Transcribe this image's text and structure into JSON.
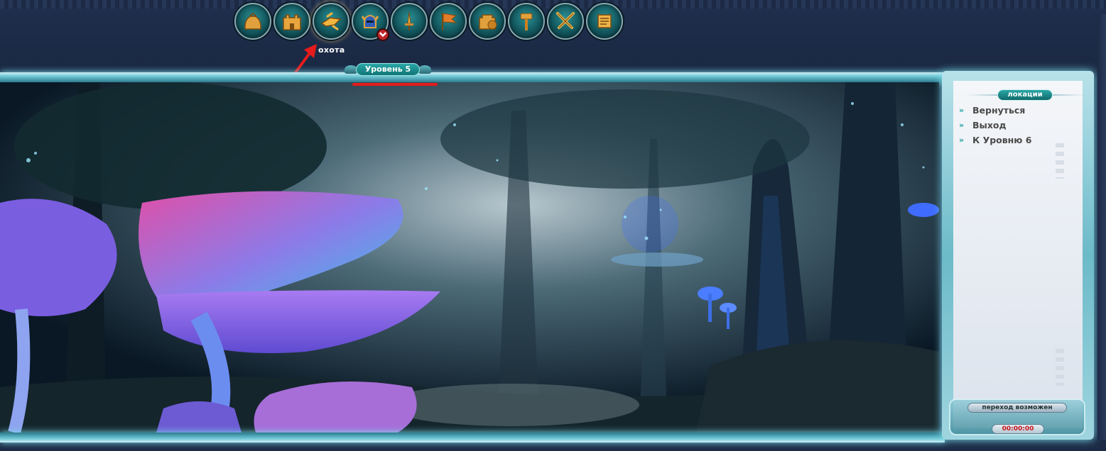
{
  "toolbar": {
    "buttons": [
      {
        "name": "bag",
        "label": ""
      },
      {
        "name": "castle",
        "label": ""
      },
      {
        "name": "hunt",
        "label": "охота"
      },
      {
        "name": "knight-helmet",
        "label": ""
      },
      {
        "name": "sword",
        "label": ""
      },
      {
        "name": "flag",
        "label": ""
      },
      {
        "name": "fortress-shield",
        "label": ""
      },
      {
        "name": "hammer",
        "label": ""
      },
      {
        "name": "crossed-swords",
        "label": ""
      },
      {
        "name": "scroll",
        "label": ""
      }
    ],
    "active_label": "охота"
  },
  "level": {
    "label": "Уровень 5"
  },
  "panel": {
    "title": "локации",
    "locations": [
      {
        "label": "Вернуться"
      },
      {
        "label": "Выход"
      },
      {
        "label": "К Уровню 6"
      }
    ],
    "transition_status": "переход возможен",
    "timer": "00:00:00"
  },
  "colors": {
    "accent_teal": "#2aa7a6",
    "frame_glow": "#7fe3f0",
    "annotation_red": "#e61b1b",
    "background": "#1c2a45"
  }
}
